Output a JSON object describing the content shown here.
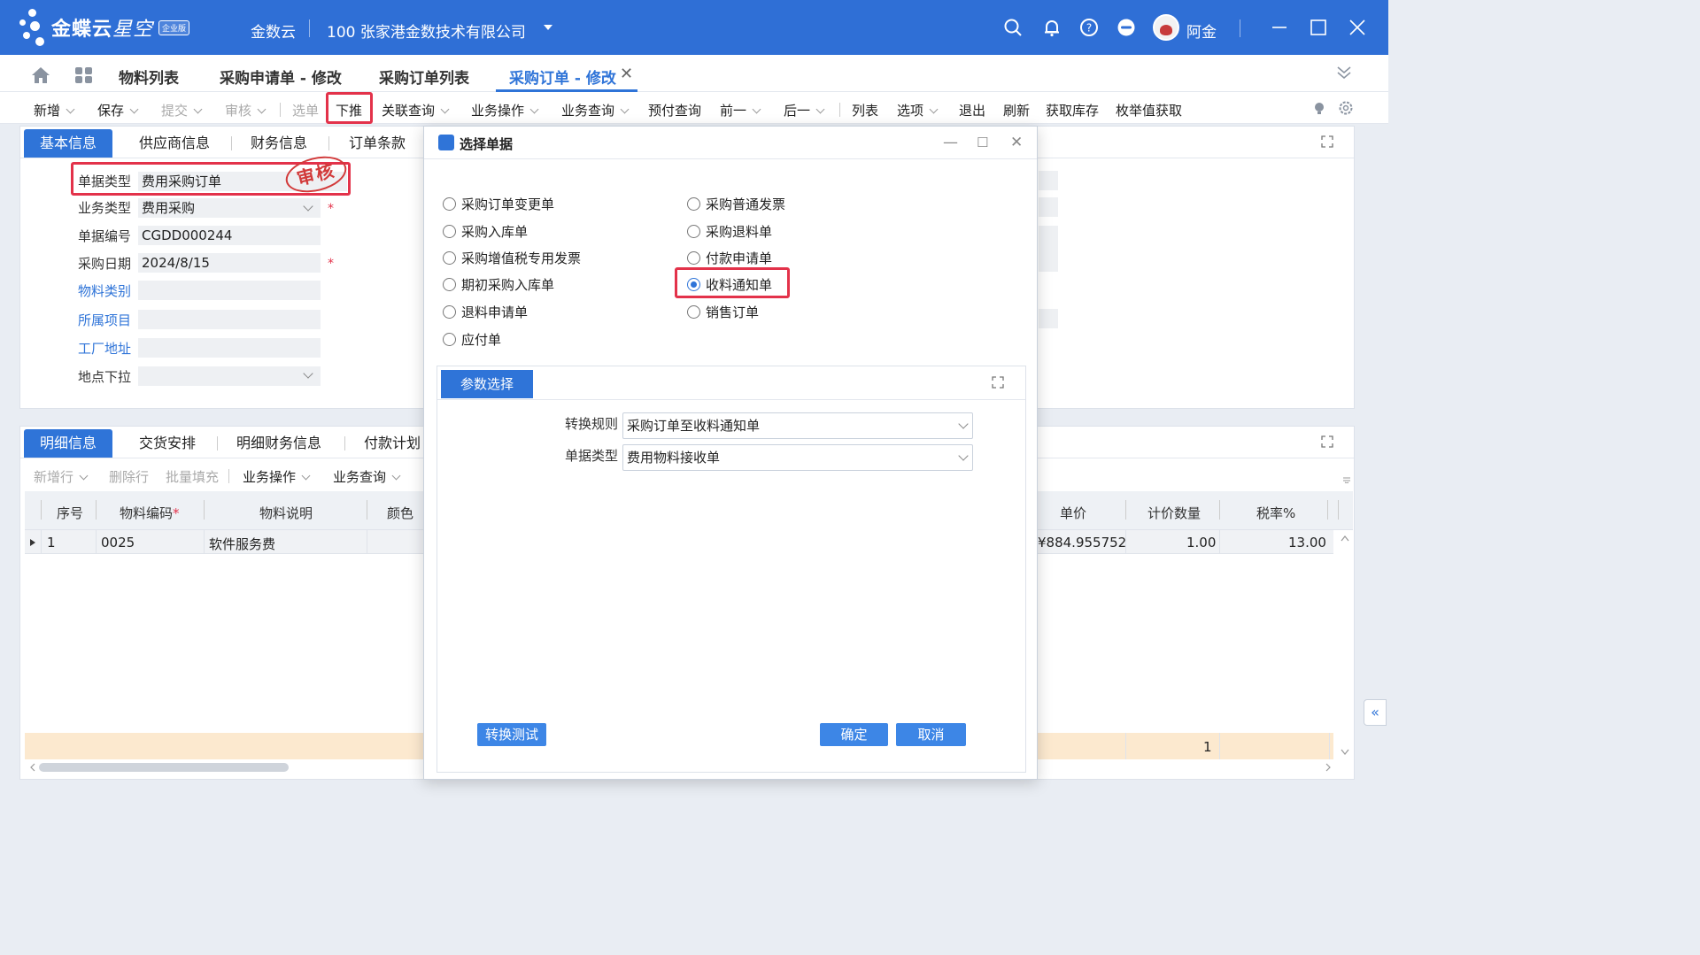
{
  "header": {
    "brand_main": "金蝶云",
    "brand_sub": "星空",
    "brand_badge": "企业版",
    "product": "金数云",
    "company": "100  张家港金数技术有限公司",
    "user_name": "阿金",
    "icons": [
      "search-icon",
      "bell-icon",
      "help-icon",
      "toggle-icon",
      "minimize-icon",
      "maximize-icon",
      "close-icon"
    ]
  },
  "tabs": [
    {
      "label": "物料列表"
    },
    {
      "label": "采购申请单 - 修改"
    },
    {
      "label": "采购订单列表"
    },
    {
      "label": "采购订单 - 修改"
    }
  ],
  "toolbar": {
    "items": [
      "新增",
      "保存",
      "提交",
      "审核",
      "选单",
      "下推",
      "关联查询",
      "业务操作",
      "业务查询",
      "预付查询",
      "前一",
      "后一",
      "列表",
      "选项",
      "退出",
      "刷新",
      "获取库存",
      "枚举值获取"
    ]
  },
  "form": {
    "tabs": [
      "基本信息",
      "供应商信息",
      "财务信息",
      "订单条款"
    ],
    "fields": [
      {
        "label": "单据类型",
        "value": "费用采购订单"
      },
      {
        "label": "业务类型",
        "value": "费用采购"
      },
      {
        "label": "单据编号",
        "value": "CGDD000244"
      },
      {
        "label": "采购日期",
        "value": "2024/8/15"
      },
      {
        "label": "物料类别",
        "value": ""
      },
      {
        "label": "所属项目",
        "value": ""
      },
      {
        "label": "工厂地址",
        "value": ""
      },
      {
        "label": "地点下拉",
        "value": ""
      }
    ],
    "required_mark": "*",
    "stamp": "审核"
  },
  "detail": {
    "tabs": [
      "明细信息",
      "交货安排",
      "明细财务信息",
      "付款计划"
    ],
    "toolbar": [
      "新增行",
      "删除行",
      "批量填充",
      "业务操作",
      "业务查询"
    ],
    "columns_left": [
      "序号",
      "物料编码",
      "物料说明",
      "颜色"
    ],
    "columns_right": [
      "单价",
      "计价数量",
      "税率%"
    ],
    "row": {
      "seq": "1",
      "code": "0025",
      "desc": "软件服务费",
      "price": "¥884.955752",
      "qty": "1.00",
      "tax": "13.00"
    },
    "total_qty": "1"
  },
  "dialog": {
    "title": "选择单据",
    "options_left": [
      "采购订单变更单",
      "采购入库单",
      "采购增值税专用发票",
      "期初采购入库单",
      "退料申请单",
      "应付单"
    ],
    "options_right": [
      "采购普通发票",
      "采购退料单",
      "付款申请单",
      "收料通知单",
      "销售订单"
    ],
    "selected": "收料通知单",
    "param_title": "参数选择",
    "rule_label": "转换规则",
    "rule_value": "采购订单至收料通知单",
    "type_label": "单据类型",
    "type_value": "费用物料接收单",
    "test_button": "转换测试",
    "ok_button": "确定",
    "cancel_button": "取消"
  },
  "colors": {
    "brand": "#2f6fd6",
    "accent": "#2f74d8",
    "highlight": "#e3324a"
  }
}
